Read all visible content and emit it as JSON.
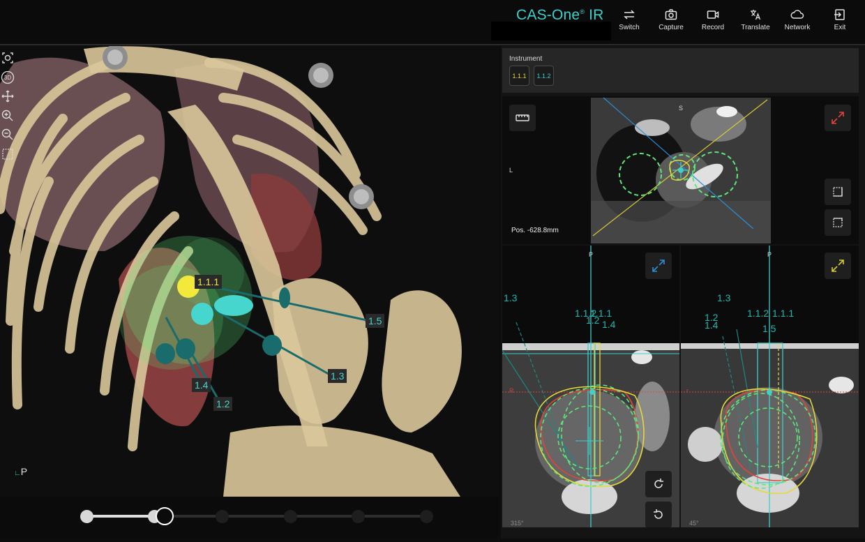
{
  "app": {
    "title_main": "CAS-One",
    "title_sup": "®",
    "title_suffix": " IR"
  },
  "toolbar": {
    "buttons": [
      {
        "label": "Switch",
        "icon": "switch-icon"
      },
      {
        "label": "Capture",
        "icon": "camera-icon"
      },
      {
        "label": "Record",
        "icon": "video-icon"
      },
      {
        "label": "Translate",
        "icon": "translate-icon"
      },
      {
        "label": "Network",
        "icon": "cloud-icon"
      },
      {
        "label": "Exit",
        "icon": "exit-icon"
      }
    ]
  },
  "viewport3d": {
    "tool_icons": [
      "reset-view-icon",
      "3d-icon",
      "pan-icon",
      "zoom-in-icon",
      "zoom-out-icon",
      "box-icon"
    ],
    "badge_3d": "3D",
    "orientation": "P",
    "trajectory_labels": [
      "1.1.1",
      "1.5",
      "1.3",
      "1.4",
      "1.2"
    ]
  },
  "stepper": {
    "steps": 6,
    "current_index": 1
  },
  "instrument": {
    "title": "Instrument",
    "buttons": [
      {
        "label": "1.1.1",
        "color": "#e6d93a"
      },
      {
        "label": "1.1.2",
        "color": "#3fd0c9"
      }
    ]
  },
  "views": {
    "top": {
      "orientation_s": "S",
      "orientation_l": "L",
      "position": "Pos. -628.8mm",
      "icons": [
        "ruler-icon",
        "expand-icon",
        "layers-icon",
        "slice-icon"
      ]
    },
    "bottom_left": {
      "orientation_p": "P",
      "orientation_r": "R",
      "angle": "315°",
      "labels": [
        "1.3",
        "1.1.2",
        "1.1.1",
        "1.2",
        "1.4"
      ],
      "icons": [
        "expand-icon",
        "rotate-ccw-icon",
        "rotate-cw-icon"
      ]
    },
    "bottom_right": {
      "orientation_p": "P",
      "orientation_r": "r",
      "angle": "45°",
      "labels": [
        "1.3",
        "1.2",
        "1.4",
        "1.1.2",
        "1.1.1",
        "1.5"
      ],
      "icons": [
        "expand-icon"
      ]
    }
  },
  "colors": {
    "accent": "#3fd0c9",
    "yellow": "#e6d93a",
    "teal_dark": "#1a6b6b",
    "bone": "#d9c79a",
    "ablation_green": "#5ee67a",
    "expand_red": "#e0453a",
    "expand_blue": "#2a8fd6",
    "expand_yellow": "#d8cc33"
  }
}
